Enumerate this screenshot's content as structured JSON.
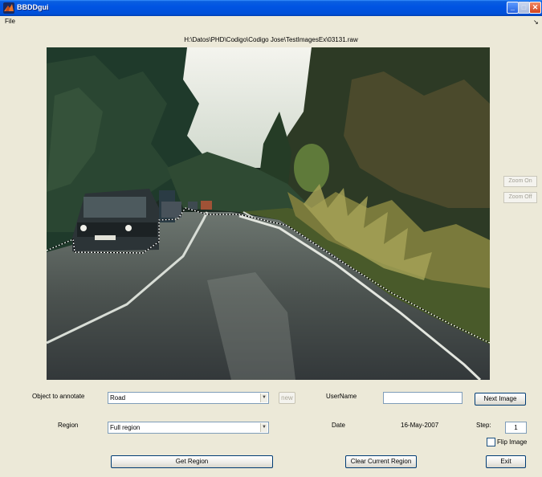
{
  "window": {
    "title": "BBDDgui",
    "minimize": "_",
    "maximize": "□",
    "close": "✕"
  },
  "menu": {
    "file": "File",
    "arrow": "↘"
  },
  "image_path": "H:\\Datos\\PHD\\Codigo\\Codigo Jose\\TestImagesEx\\03131.raw",
  "zoom": {
    "on": "Zoom On",
    "off": "Zoom Off"
  },
  "controls": {
    "object_label": "Object to annotate",
    "object_value": "Road",
    "new_label": "new",
    "username_label": "UserName",
    "username_value": "",
    "next_image": "Next Image",
    "region_label": "Region",
    "region_value": "Full region",
    "date_label": "Date",
    "date_value": "16-May-2007",
    "step_label": "Step:",
    "step_value": "1",
    "flip_label": "Flip Image",
    "flip_checked": false,
    "get_region": "Get Region",
    "clear_region": "Clear Current Region",
    "exit": "Exit"
  },
  "colors": {
    "titlebar": "#0054e3",
    "dialog_bg": "#ece9d8",
    "field_border": "#7f9db9"
  }
}
